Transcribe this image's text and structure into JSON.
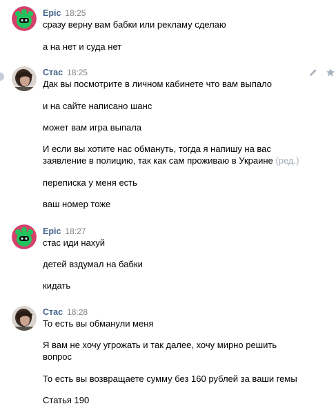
{
  "messages": [
    {
      "author": "Epic",
      "time": "18:25",
      "lines": [
        "сразу верну вам бабки или рекламу сделаю",
        "а на нет и суда нет"
      ]
    },
    {
      "author": "Стас",
      "time": "18:25",
      "lines": [
        "Дак вы посмотрите в личном кабинете что вам выпало",
        "и на сайте написано шанс",
        "может вам игра выпала",
        "И если вы хотите нас обмануть, тогда я напишу на вас",
        "заявление в полицию, так как сам проживаю в Украине",
        "переписка у меня есть",
        "ваш номер тоже"
      ],
      "edited_label": "(ред.)"
    },
    {
      "author": "Epic",
      "time": "18:27",
      "lines": [
        "стас иди нахуй",
        "детей вздумал на бабки",
        "кидать"
      ]
    },
    {
      "author": "Стас",
      "time": "18:28",
      "lines": [
        "То есть вы обманули меня",
        "Я вам не хочу угрожать и так далее, хочу мирно решить",
        "вопрос",
        "То есть вы возвращаете сумму без 160 рублей за ваши гемы",
        "Статья 190"
      ]
    }
  ],
  "icons": {
    "edit": "pencil-icon",
    "favorite": "star-icon",
    "epic_avatar": "green-creature-avatar",
    "stas_avatar": "user-photo-avatar"
  },
  "colors": {
    "author": "#42648b",
    "time": "#828282",
    "edited": "#a5adb8",
    "action_icons": "#a8b3c1"
  }
}
